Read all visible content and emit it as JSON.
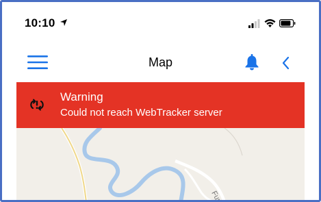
{
  "status_bar": {
    "time": "10:10",
    "location_icon": "location-arrow-icon",
    "signal_icon": "cellular-signal-icon",
    "wifi_icon": "wifi-icon",
    "battery_icon": "battery-icon"
  },
  "navbar": {
    "title": "Map",
    "menu_icon": "hamburger-menu-icon",
    "bell_icon": "bell-icon",
    "back_icon": "chevron-left-icon"
  },
  "warning": {
    "title": "Warning",
    "message": "Could not reach WebTracker server",
    "icon": "sync-error-icon"
  },
  "map": {
    "road_label": "Fur"
  },
  "colors": {
    "accent": "#1a73e8",
    "warning_bg": "#e43325",
    "frame_border": "#4a6fc4",
    "map_bg": "#f2efe9",
    "river": "#a8c8ea"
  }
}
